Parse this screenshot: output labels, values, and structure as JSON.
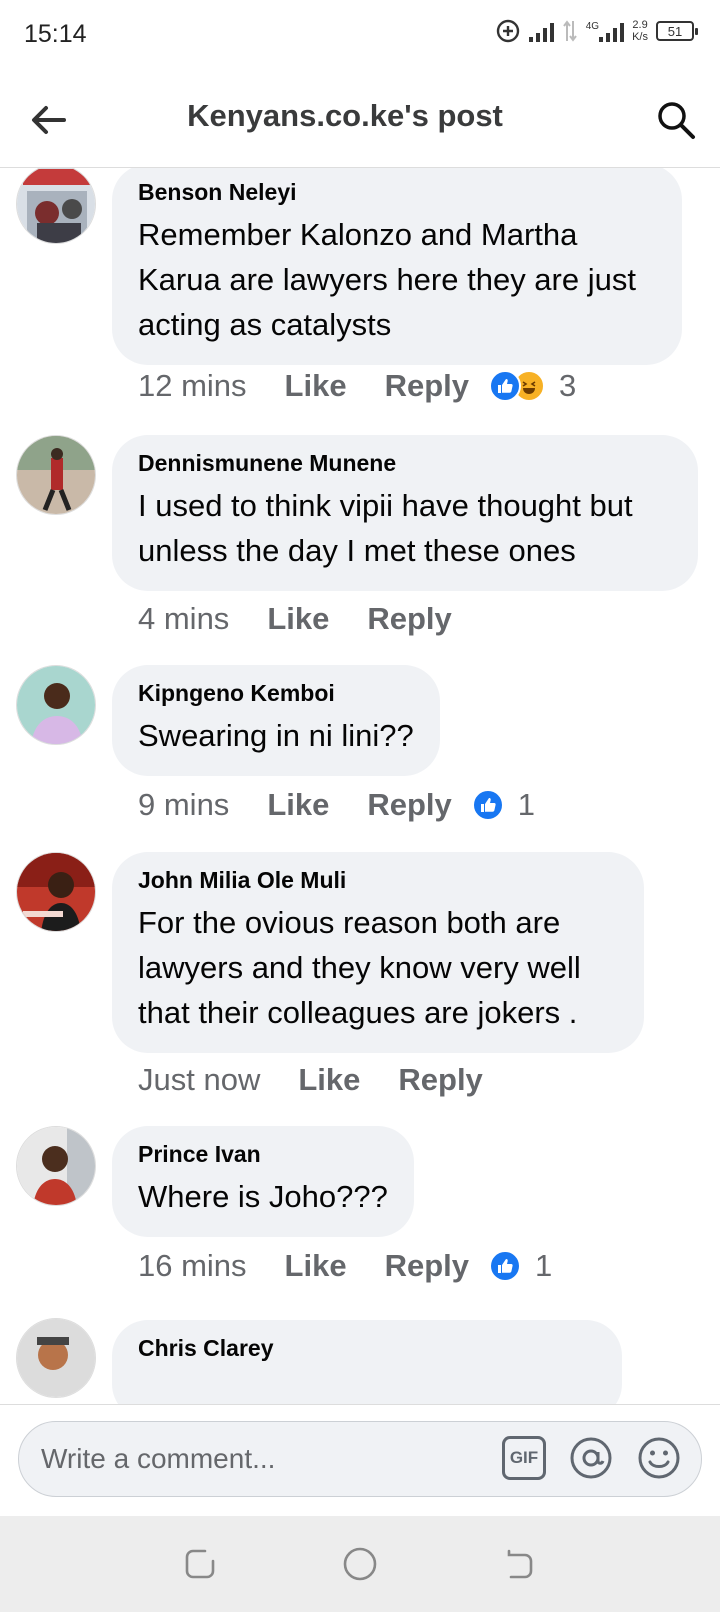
{
  "status_bar": {
    "time": "15:14",
    "network": "4G",
    "speed_value": "2.9",
    "speed_unit": "K/s",
    "battery": "51"
  },
  "header": {
    "title": "Kenyans.co.ke's post"
  },
  "comments": [
    {
      "author": "Benson Neleyi",
      "text": "Remember Kalonzo and Martha Karua are lawyers here they are just acting as catalysts",
      "time": "12 mins",
      "like_label": "Like",
      "reply_label": "Reply",
      "reactions": [
        "like",
        "haha"
      ],
      "reaction_count": "3"
    },
    {
      "author": "Dennismunene Munene",
      "text": "I used to think vipii have thought but unless the day I met these ones",
      "time": "4 mins",
      "like_label": "Like",
      "reply_label": "Reply",
      "reactions": [],
      "reaction_count": ""
    },
    {
      "author": "Kipngeno Kemboi",
      "text": "Swearing in ni lini??",
      "time": "9 mins",
      "like_label": "Like",
      "reply_label": "Reply",
      "reactions": [
        "like"
      ],
      "reaction_count": "1"
    },
    {
      "author": "John Milia Ole Muli",
      "text": "For the ovious reason both are lawyers and they know very well that their colleagues are jokers .",
      "time": "Just now",
      "like_label": "Like",
      "reply_label": "Reply",
      "reactions": [],
      "reaction_count": ""
    },
    {
      "author": "Prince Ivan",
      "text": "Where is Joho???",
      "time": "16 mins",
      "like_label": "Like",
      "reply_label": "Reply",
      "reactions": [
        "like"
      ],
      "reaction_count": "1"
    },
    {
      "author": "Chris Clarey",
      "text": "",
      "time": "",
      "like_label": "",
      "reply_label": "",
      "reactions": [],
      "reaction_count": ""
    }
  ],
  "composer": {
    "placeholder": "Write a comment...",
    "gif_label": "GIF"
  },
  "colors": {
    "facebook_blue": "#1877f2",
    "bubble_bg": "#f0f2f5",
    "secondary_text": "#65676b"
  }
}
